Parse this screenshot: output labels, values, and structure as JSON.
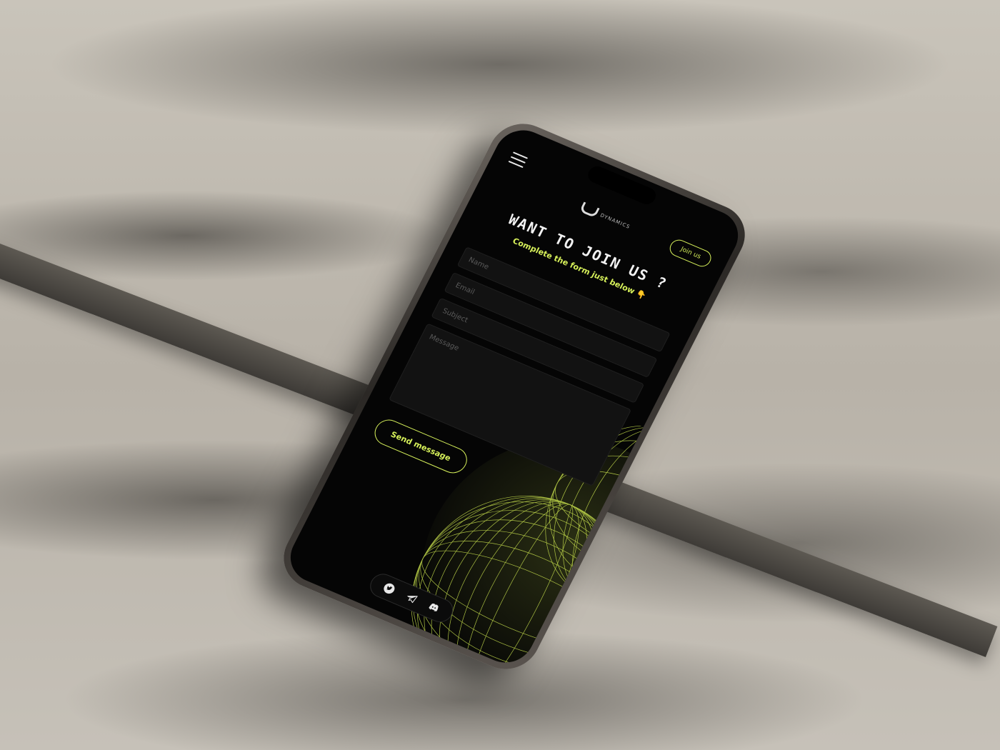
{
  "header": {
    "menu_icon": "hamburger-menu-icon",
    "logo_text": "DYNAMICS",
    "join_label": "Join us"
  },
  "hero": {
    "title": "WANT TO JOIN US ?",
    "subtitle": "Complete the form just below 👇"
  },
  "form": {
    "name_placeholder": "Name",
    "email_placeholder": "Email",
    "subject_placeholder": "Subject",
    "message_placeholder": "Message",
    "send_label": "Send message"
  },
  "social": {
    "icons": [
      "twitter-icon",
      "telegram-icon",
      "discord-icon"
    ]
  },
  "colors": {
    "accent": "#d6f05a",
    "background": "#050505"
  }
}
